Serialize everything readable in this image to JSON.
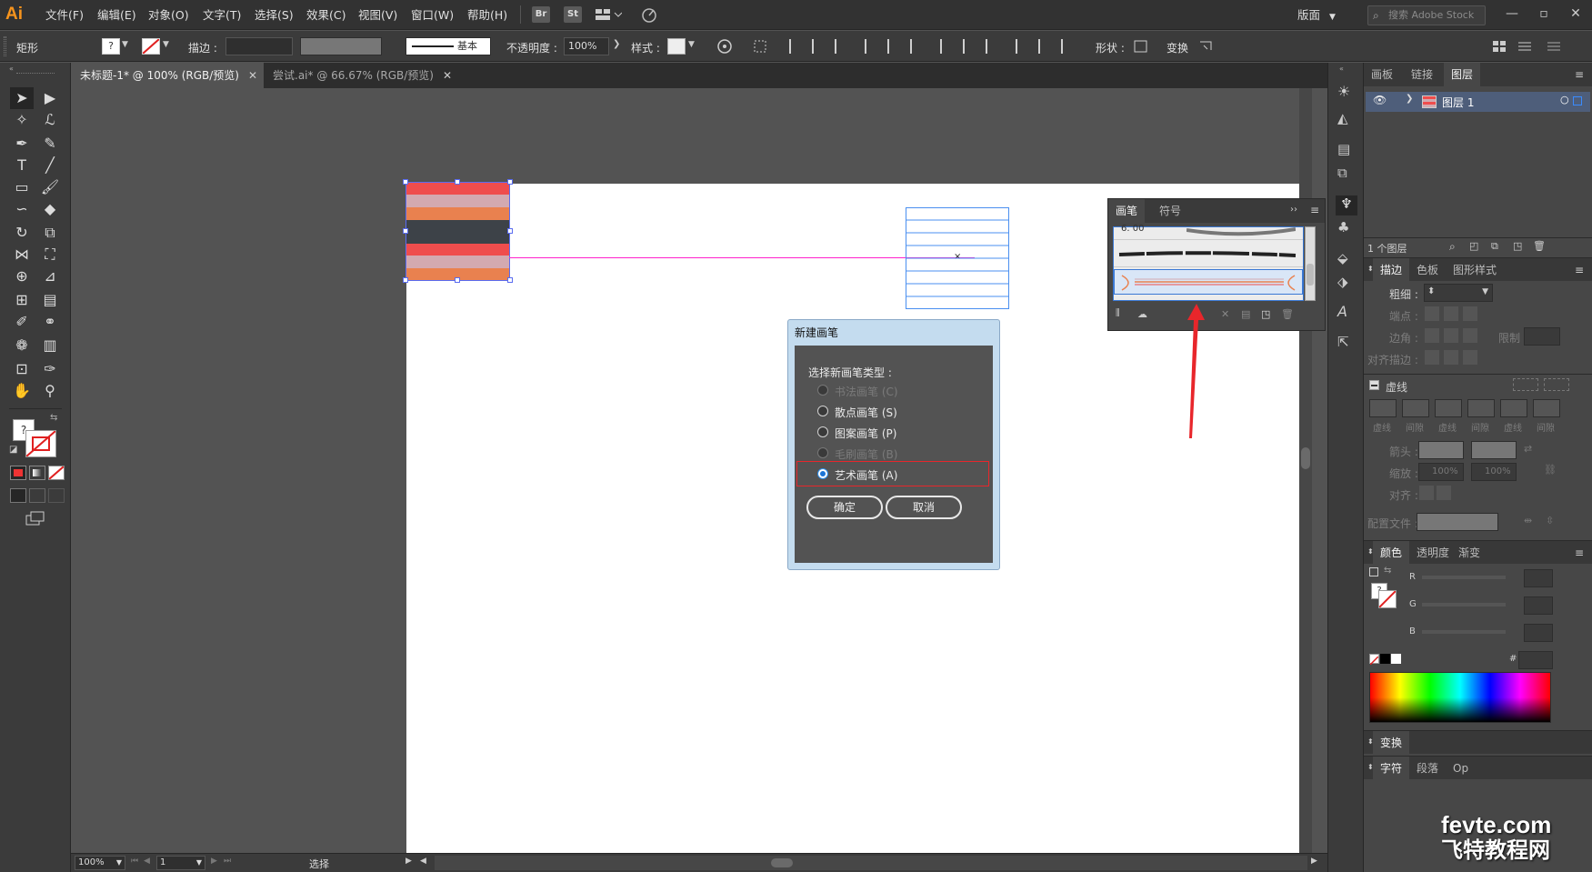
{
  "app": {
    "logo": "Ai"
  },
  "menu": [
    "文件(F)",
    "编辑(E)",
    "对象(O)",
    "文字(T)",
    "选择(S)",
    "效果(C)",
    "视图(V)",
    "窗口(W)",
    "帮助(H)"
  ],
  "menu_icons": [
    "Br",
    "St"
  ],
  "workspace": {
    "label": "版面"
  },
  "search": {
    "placeholder": "搜索 Adobe Stock"
  },
  "control_bar": {
    "object_type": "矩形",
    "stroke_label": "描边 :",
    "stroke_style": "基本",
    "opacity_label": "不透明度 :",
    "opacity_value": "100%",
    "style_label": "样式 :",
    "shape_label": "形状 :",
    "transform_label": "变换"
  },
  "tabs": [
    {
      "label": "未标题-1* @ 100% (RGB/预览)",
      "active": true
    },
    {
      "label": "尝试.ai* @ 66.67% (RGB/预览)",
      "active": false
    }
  ],
  "brush_panel": {
    "tabs": [
      "画笔",
      "符号"
    ],
    "brush_size_label": "6. 00"
  },
  "dialog": {
    "title": "新建画笔",
    "prompt": "选择新画笔类型 :",
    "options": [
      {
        "label": "书法画笔 (C)",
        "enabled": false,
        "selected": false
      },
      {
        "label": "散点画笔 (S)",
        "enabled": true,
        "selected": false
      },
      {
        "label": "图案画笔 (P)",
        "enabled": true,
        "selected": false
      },
      {
        "label": "毛刷画笔 (B)",
        "enabled": false,
        "selected": false
      },
      {
        "label": "艺术画笔 (A)",
        "enabled": true,
        "selected": true
      }
    ],
    "ok": "确定",
    "cancel": "取消"
  },
  "layers_panel": {
    "tabs": [
      "画板",
      "链接",
      "图层"
    ],
    "layer_name": "图层 1",
    "footer": "1 个图层"
  },
  "stroke_panel": {
    "tabs": [
      "描边",
      "色板",
      "图形样式"
    ],
    "weight_label": "粗细 :",
    "cap_label": "端点 :",
    "corner_label": "边角 :",
    "limit_label": "限制 :",
    "align_label": "对齐描边 :",
    "dashed_label": "虚线",
    "dash_labels": [
      "虚线",
      "间隙",
      "虚线",
      "间隙",
      "虚线",
      "间隙"
    ],
    "arrow_label": "箭头 :",
    "scale_label": "缩放 :",
    "scale_values": [
      "100%",
      "100%"
    ],
    "align2_label": "对齐 :",
    "profile_label": "配置文件 :"
  },
  "color_panel": {
    "tabs": [
      "颜色",
      "透明度",
      "渐变"
    ],
    "channels": [
      "R",
      "G",
      "B"
    ],
    "hex_label": "#"
  },
  "bottom_panels": {
    "transform": "变换",
    "character": "字符",
    "paragraph": "段落",
    "opentype": "Op"
  },
  "status": {
    "zoom": "100%",
    "page": "1",
    "tool": "选择"
  },
  "watermark": {
    "line1": "fevte.com",
    "line2": "飞特教程网"
  },
  "colors": {
    "accent": "#1473e6",
    "stripe_red": "#ef4d4d",
    "stripe_pink": "#d3a9b0",
    "stripe_orange": "#e9814f",
    "stripe_dark": "#3d4248",
    "guide_magenta": "#ff22cc",
    "annotation_red": "#e8262b"
  }
}
